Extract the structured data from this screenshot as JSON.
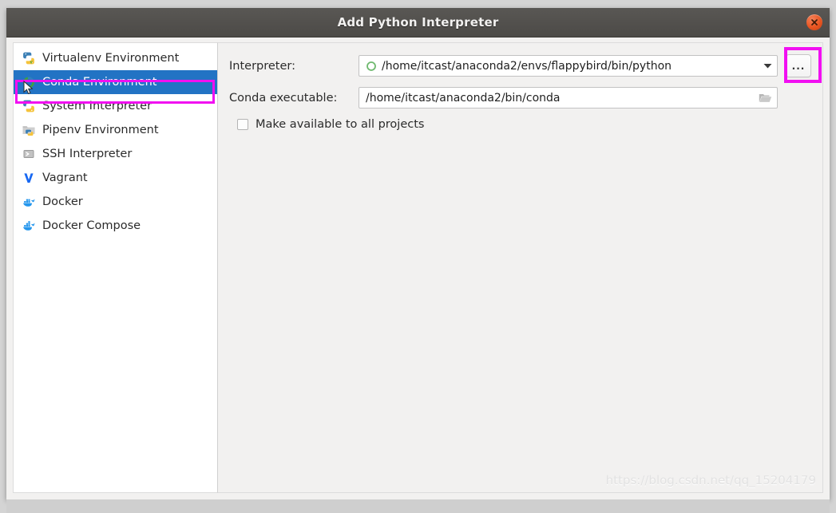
{
  "window": {
    "title": "Add Python Interpreter",
    "close_icon": "close-icon"
  },
  "sidebar": {
    "items": [
      {
        "label": "Virtualenv Environment",
        "icon": "python-virtualenv-icon",
        "selected": false
      },
      {
        "label": "Conda Environment",
        "icon": "conda-icon",
        "selected": true
      },
      {
        "label": "System Interpreter",
        "icon": "python-icon",
        "selected": false
      },
      {
        "label": "Pipenv Environment",
        "icon": "pipenv-folder-icon",
        "selected": false
      },
      {
        "label": "SSH Interpreter",
        "icon": "ssh-terminal-icon",
        "selected": false
      },
      {
        "label": "Vagrant",
        "icon": "vagrant-icon",
        "selected": false
      },
      {
        "label": "Docker",
        "icon": "docker-icon",
        "selected": false
      },
      {
        "label": "Docker Compose",
        "icon": "docker-compose-icon",
        "selected": false
      }
    ]
  },
  "form": {
    "interpreter": {
      "label": "Interpreter:",
      "value": "/home/itcast/anaconda2/envs/flappybird/bin/python",
      "icon": "conda-ring-icon",
      "dropdown_icon": "chevron-down-icon",
      "browse_label": "..."
    },
    "conda_executable": {
      "label": "Conda executable:",
      "value": "/home/itcast/anaconda2/bin/conda",
      "browse_icon": "folder-open-icon"
    },
    "make_available": {
      "label": "Make available to all projects",
      "checked": false
    }
  },
  "annotations": {
    "highlight_color": "#f10ff1",
    "selection_color": "#2273c4"
  },
  "watermark": {
    "text": "https://blog.csdn.net/qq_15204179"
  }
}
